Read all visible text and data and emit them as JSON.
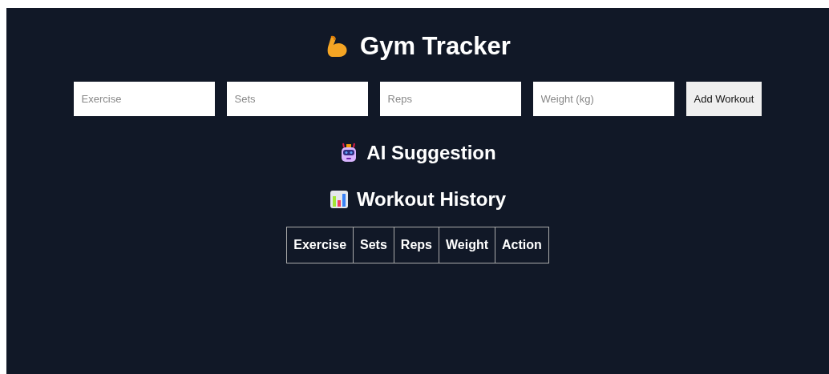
{
  "title": "Gym Tracker",
  "form": {
    "fields": [
      {
        "placeholder": "Exercise"
      },
      {
        "placeholder": "Sets"
      },
      {
        "placeholder": "Reps"
      },
      {
        "placeholder": "Weight (kg)"
      }
    ],
    "button": "Add Workout"
  },
  "suggestion": {
    "heading": "AI Suggestion"
  },
  "history": {
    "heading": "Workout History",
    "columns": [
      "Exercise",
      "Sets",
      "Reps",
      "Weight",
      "Action"
    ]
  }
}
